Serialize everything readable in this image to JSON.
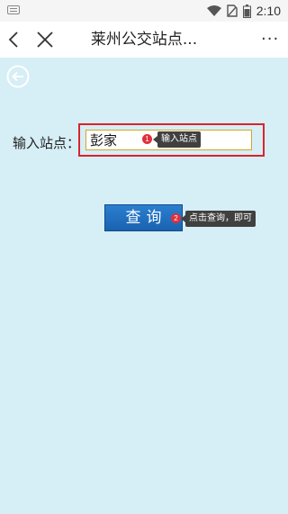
{
  "status_bar": {
    "time": "2:10"
  },
  "nav": {
    "title": "莱州公交站点...",
    "more": "···"
  },
  "form": {
    "label": "输入站点：",
    "input_value": "彭家"
  },
  "annotations": [
    {
      "number": "1",
      "text": "输入站点"
    },
    {
      "number": "2",
      "text": "点击查询，即可"
    }
  ],
  "query_button": {
    "label": "查询"
  },
  "colors": {
    "content_bg": "#d6eef6",
    "button_blue": "#1a62b0",
    "highlight_red": "#d9232d"
  }
}
